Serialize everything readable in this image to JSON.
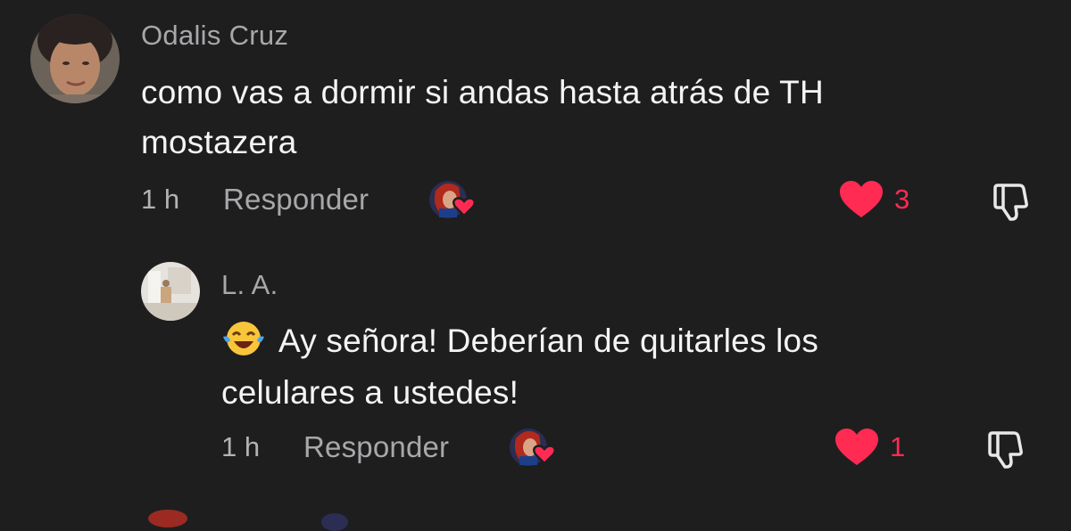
{
  "comments": [
    {
      "username": "Odalis Cruz",
      "text_line1": "como vas a dormir si andas hasta atrás de TH",
      "text_line2": "mostazera",
      "time": "1 h",
      "reply_label": "Responder",
      "likes": "3",
      "liked": true
    },
    {
      "username": "L. A.",
      "emoji": "😂",
      "text_line1": "Ay señora! Deberían de quitarles los",
      "text_line2": "celulares a ustedes!",
      "time": "1 h",
      "reply_label": "Responder",
      "likes": "1",
      "liked": true
    }
  ],
  "colors": {
    "background": "#1e1e1f",
    "like_red": "#ff2b53",
    "text": "#f4f4f4",
    "muted": "#a8a8ab"
  },
  "icons": [
    "heart-icon",
    "dislike-icon",
    "creator-liked-badge"
  ]
}
